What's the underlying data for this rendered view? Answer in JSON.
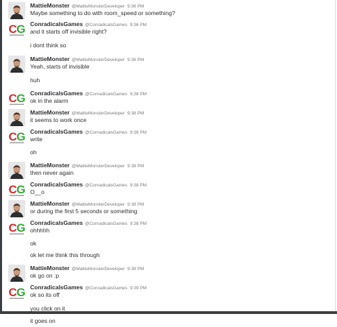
{
  "users": {
    "mattie": {
      "name": "MattieMonster",
      "handle": "@MattieMonsterDeveloper"
    },
    "conrad": {
      "name": "ConradicalsGames",
      "handle": "@ConradicalsGames"
    }
  },
  "messages": [
    {
      "user": "mattie",
      "time": "9:36 PM",
      "text": "Maybe something to do with room_speed or something?"
    },
    {
      "user": "conrad",
      "time": "9:36 PM",
      "text": "and it starts off invisible right?"
    },
    {
      "user": "conrad",
      "cont": true,
      "text": "i dont think so"
    },
    {
      "user": "mattie",
      "time": "9:36 PM",
      "text": "Yeah, starts of invisible"
    },
    {
      "user": "mattie",
      "cont": true,
      "text": "huh"
    },
    {
      "user": "conrad",
      "time": "9:38 PM",
      "text": "ok in the alarm"
    },
    {
      "user": "mattie",
      "time": "9:38 PM",
      "text": "it seems to work once"
    },
    {
      "user": "conrad",
      "time": "9:38 PM",
      "text": "write"
    },
    {
      "user": "conrad",
      "cont": true,
      "text": "oh"
    },
    {
      "user": "mattie",
      "time": "9:38 PM",
      "text": "then never again"
    },
    {
      "user": "conrad",
      "time": "9:38 PM",
      "text": "O__o"
    },
    {
      "user": "mattie",
      "time": "9:38 PM",
      "text": "or during the first 5 seconds or something"
    },
    {
      "user": "conrad",
      "time": "9:38 PM",
      "text": "ohhhhh"
    },
    {
      "user": "conrad",
      "cont": true,
      "text": "ok"
    },
    {
      "user": "conrad",
      "cont": true,
      "text": "ok let me think this through"
    },
    {
      "user": "mattie",
      "time": "9:38 PM",
      "text": "ok go on :p"
    },
    {
      "user": "conrad",
      "time": "9:39 PM",
      "text": "ok so its off"
    },
    {
      "user": "conrad",
      "cont": true,
      "text": "you click on it"
    },
    {
      "user": "conrad",
      "cont": true,
      "text": "it goes on"
    }
  ],
  "colors": {
    "cg_red": "#d62b2b",
    "cg_green": "#35a838",
    "text": "#2c2d30",
    "muted": "#7a7a7a"
  }
}
